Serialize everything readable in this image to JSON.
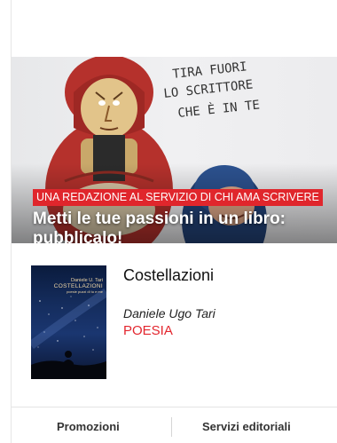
{
  "hero": {
    "badge": "UNA REDAZIONE AL SERVIZIO DI CHI AMA SCRIVERE",
    "title": "Metti le tue passioni in un libro: pubblicalo!",
    "handwritten_line1": "TIRA FUORI",
    "handwritten_line2": "LO SCRITTORE",
    "handwritten_line3": "CHE È IN TE"
  },
  "book": {
    "title": "Costellazioni",
    "author": "Daniele Ugo Tari",
    "genre": "POESIA",
    "cover_author": "Daniele U. Tari",
    "cover_title": "COSTELLAZIONI",
    "cover_subtitle": "poesie puzzi di tu e me"
  },
  "tabs": {
    "promotions": "Promozioni",
    "editorial": "Servizi editoriali"
  },
  "colors": {
    "accent_red": "#e0262c",
    "genre_red": "#e3262e"
  }
}
